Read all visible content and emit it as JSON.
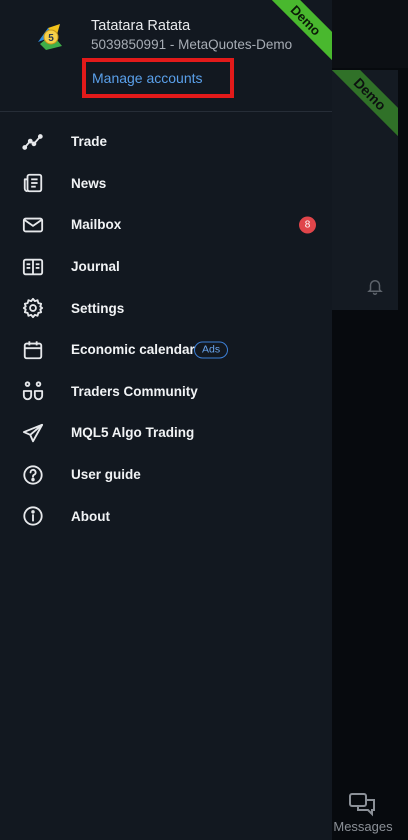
{
  "account": {
    "name": "Tatatara Ratata",
    "details": "5039850991 - MetaQuotes-Demo",
    "manage_label": "Manage accounts",
    "demo_ribbon": "Demo"
  },
  "menu": {
    "items": [
      {
        "label": "Trade",
        "icon": "trade-chart-icon"
      },
      {
        "label": "News",
        "icon": "news-icon"
      },
      {
        "label": "Mailbox",
        "icon": "mail-icon",
        "badge": "8"
      },
      {
        "label": "Journal",
        "icon": "journal-icon"
      },
      {
        "label": "Settings",
        "icon": "gear-icon"
      },
      {
        "label": "Economic calendar",
        "icon": "calendar-icon",
        "chip": "Ads"
      },
      {
        "label": "Traders Community",
        "icon": "community-icon"
      },
      {
        "label": "MQL5 Algo Trading",
        "icon": "send-icon"
      },
      {
        "label": "User guide",
        "icon": "help-icon"
      },
      {
        "label": "About",
        "icon": "info-icon"
      }
    ]
  },
  "background": {
    "card_ribbon": "Demo",
    "messages_label": "Messages"
  },
  "colors": {
    "drawer_bg": "#121820",
    "accent_link": "#5aa0ea",
    "highlight_box": "#e21a1a",
    "badge": "#e0454a",
    "demo_green": "#49b82e"
  }
}
